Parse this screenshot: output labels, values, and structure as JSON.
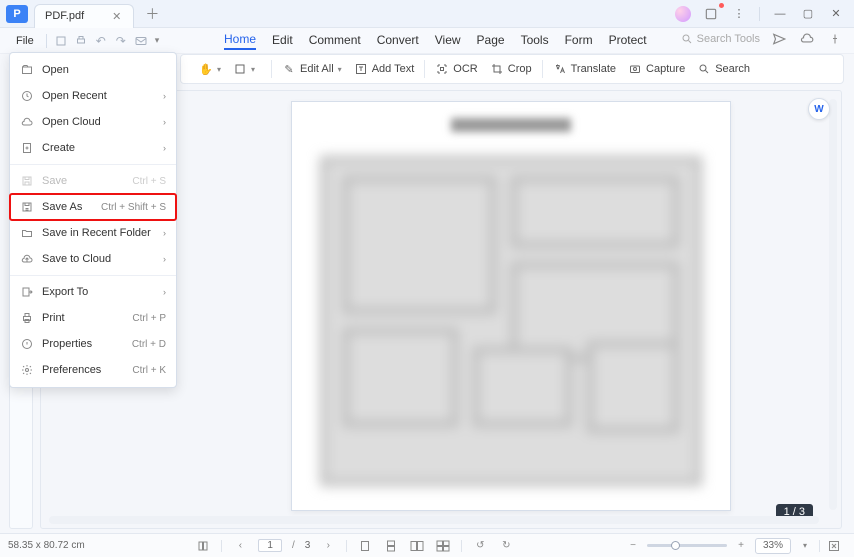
{
  "window": {
    "tab_title": "PDF.pdf",
    "controls": {
      "minimize": "—",
      "maximize": "▢",
      "close": "✕"
    }
  },
  "quick_access": {
    "file_label": "File"
  },
  "menubar": {
    "items": [
      "Home",
      "Edit",
      "Comment",
      "Convert",
      "View",
      "Page",
      "Tools",
      "Form",
      "Protect"
    ],
    "active_index": 0,
    "search_placeholder": "Search Tools"
  },
  "toolbar": {
    "edit_all": "Edit All",
    "add_text": "Add Text",
    "ocr": "OCR",
    "crop": "Crop",
    "translate": "Translate",
    "capture": "Capture",
    "search": "Search"
  },
  "file_menu": {
    "items": [
      {
        "id": "open",
        "label": "Open",
        "icon": "open-icon",
        "submenu": false
      },
      {
        "id": "open_recent",
        "label": "Open Recent",
        "icon": "recent-icon",
        "submenu": true
      },
      {
        "id": "open_cloud",
        "label": "Open Cloud",
        "icon": "cloud-icon",
        "submenu": true
      },
      {
        "id": "create",
        "label": "Create",
        "icon": "create-icon",
        "submenu": true
      },
      {
        "sep": true
      },
      {
        "id": "save",
        "label": "Save",
        "icon": "save-icon",
        "shortcut": "Ctrl + S",
        "disabled": true
      },
      {
        "id": "save_as",
        "label": "Save As",
        "icon": "saveas-icon",
        "shortcut": "Ctrl + Shift + S",
        "highlight": true
      },
      {
        "id": "save_recent_folder",
        "label": "Save in Recent Folder",
        "icon": "folder-icon",
        "submenu": true
      },
      {
        "id": "save_cloud",
        "label": "Save to Cloud",
        "icon": "cloud-up-icon",
        "submenu": true
      },
      {
        "sep": true
      },
      {
        "id": "export_to",
        "label": "Export To",
        "icon": "export-icon",
        "submenu": true
      },
      {
        "id": "print",
        "label": "Print",
        "icon": "print-icon",
        "shortcut": "Ctrl + P"
      },
      {
        "id": "properties",
        "label": "Properties",
        "icon": "props-icon",
        "shortcut": "Ctrl + D"
      },
      {
        "id": "preferences",
        "label": "Preferences",
        "icon": "prefs-icon",
        "shortcut": "Ctrl + K"
      }
    ]
  },
  "document": {
    "page_indicator": "1 / 3",
    "page_nav": {
      "page": "1",
      "total": "3"
    }
  },
  "statusbar": {
    "dimensions": "58.35 x 80.72 cm",
    "zoom_value": "33%"
  },
  "corner_badge": "W"
}
